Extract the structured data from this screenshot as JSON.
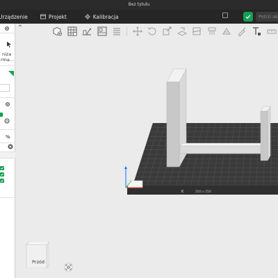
{
  "window": {
    "title": "Bez tytułu"
  },
  "nav": {
    "device_label": "Urządzenie",
    "project_label": "Projekt",
    "calibration_label": "Kalibracja",
    "print_placeholder": "Potrzi akt"
  },
  "sidebar": {
    "partial_text_1": "niza",
    "partial_text_2": "rma..."
  },
  "viewport": {
    "bed_brand": "K",
    "bed_size": "250 x 250",
    "view_label": "Przód"
  },
  "colors": {
    "accent_green": "#14a053",
    "topbar": "#262626",
    "bed": "#3a3a3a",
    "axis_x": "#ff3b30",
    "axis_y": "#34c759",
    "axis_z": "#007aff"
  },
  "icons": [
    "device-icon",
    "project-icon",
    "calibration-icon",
    "gear-icon",
    "check-icon",
    "percent-icon",
    "close-icon",
    "cube-icon",
    "cursor-icon"
  ]
}
